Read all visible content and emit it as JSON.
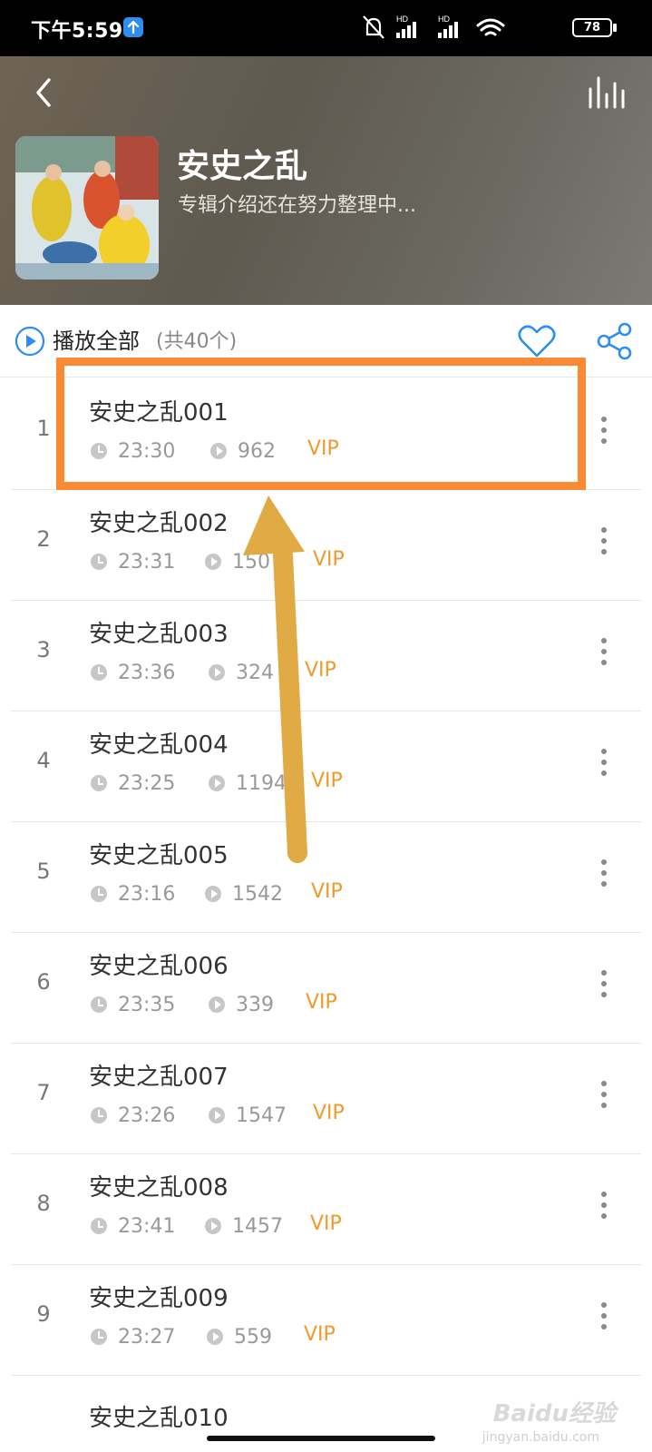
{
  "status_bar": {
    "time": "下午5:59",
    "battery": "78"
  },
  "header": {
    "album_title": "安史之乱",
    "album_description": "专辑介绍还在努力整理中..."
  },
  "play_bar": {
    "play_all_label": "播放全部",
    "count_label": "(共40个)"
  },
  "tracks": [
    {
      "index": "1",
      "title": "安史之乱001",
      "duration": "23:30",
      "plays": "962",
      "badge": "VIP"
    },
    {
      "index": "2",
      "title": "安史之乱002",
      "duration": "23:31",
      "plays": "150",
      "badge": "VIP"
    },
    {
      "index": "3",
      "title": "安史之乱003",
      "duration": "23:36",
      "plays": "324",
      "badge": "VIP"
    },
    {
      "index": "4",
      "title": "安史之乱004",
      "duration": "23:25",
      "plays": "1194",
      "badge": "VIP"
    },
    {
      "index": "5",
      "title": "安史之乱005",
      "duration": "23:16",
      "plays": "1542",
      "badge": "VIP"
    },
    {
      "index": "6",
      "title": "安史之乱006",
      "duration": "23:35",
      "plays": "339",
      "badge": "VIP"
    },
    {
      "index": "7",
      "title": "安史之乱007",
      "duration": "23:26",
      "plays": "1547",
      "badge": "VIP"
    },
    {
      "index": "8",
      "title": "安史之乱008",
      "duration": "23:41",
      "plays": "1457",
      "badge": "VIP"
    },
    {
      "index": "9",
      "title": "安史之乱009",
      "duration": "23:27",
      "plays": "559",
      "badge": "VIP"
    },
    {
      "index": "",
      "title": "安史之乱010",
      "duration": "",
      "plays": "",
      "badge": ""
    }
  ],
  "colors": {
    "accent": "#2d8df0",
    "vip": "#f09a2a",
    "highlight": "#fb8a35",
    "arrow": "#e0aa45"
  },
  "watermark": {
    "brand": "Baidu经验",
    "url": "jingyan.baidu.com"
  }
}
